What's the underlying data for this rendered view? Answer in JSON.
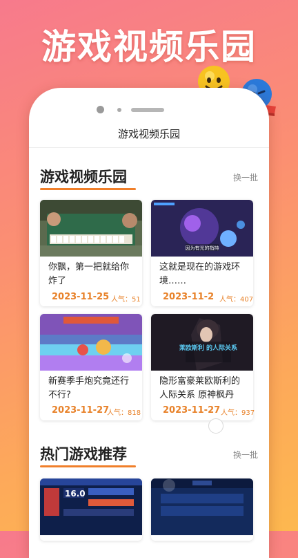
{
  "promo": {
    "title": "游戏视频乐园"
  },
  "nav": {
    "title": "游戏视频乐园"
  },
  "sections": [
    {
      "title": "游戏视频乐园",
      "refresh_label": "换一批",
      "cards": [
        {
          "title": "你飘，第一把就给你炸了",
          "date": "2023-11-25",
          "popularity": "人气：51"
        },
        {
          "title": "这就是现在的游戏环境……",
          "date": "2023-11-2",
          "popularity": "人气：407"
        },
        {
          "title": "新赛季手炮究竟还行不行?",
          "date": "2023-11-27",
          "popularity": "人气：818"
        },
        {
          "title": "隐形富豪莱欧斯利的人际关系 原神枫丹",
          "date": "2023-11-27",
          "popularity": "人气：937"
        }
      ]
    },
    {
      "title": "热门游戏推荐",
      "refresh_label": "换一批"
    }
  ],
  "thumb_captions": {
    "card2_text": "因为有光的指持",
    "card4_text": "莱欧斯利 的人际关系",
    "hot1_score": "16.0"
  },
  "colors": {
    "accent": "#f07f2a",
    "date": "#e8822a"
  },
  "icons": [
    "happy-face-icon",
    "sad-face-icon",
    "seesaw-icon"
  ]
}
